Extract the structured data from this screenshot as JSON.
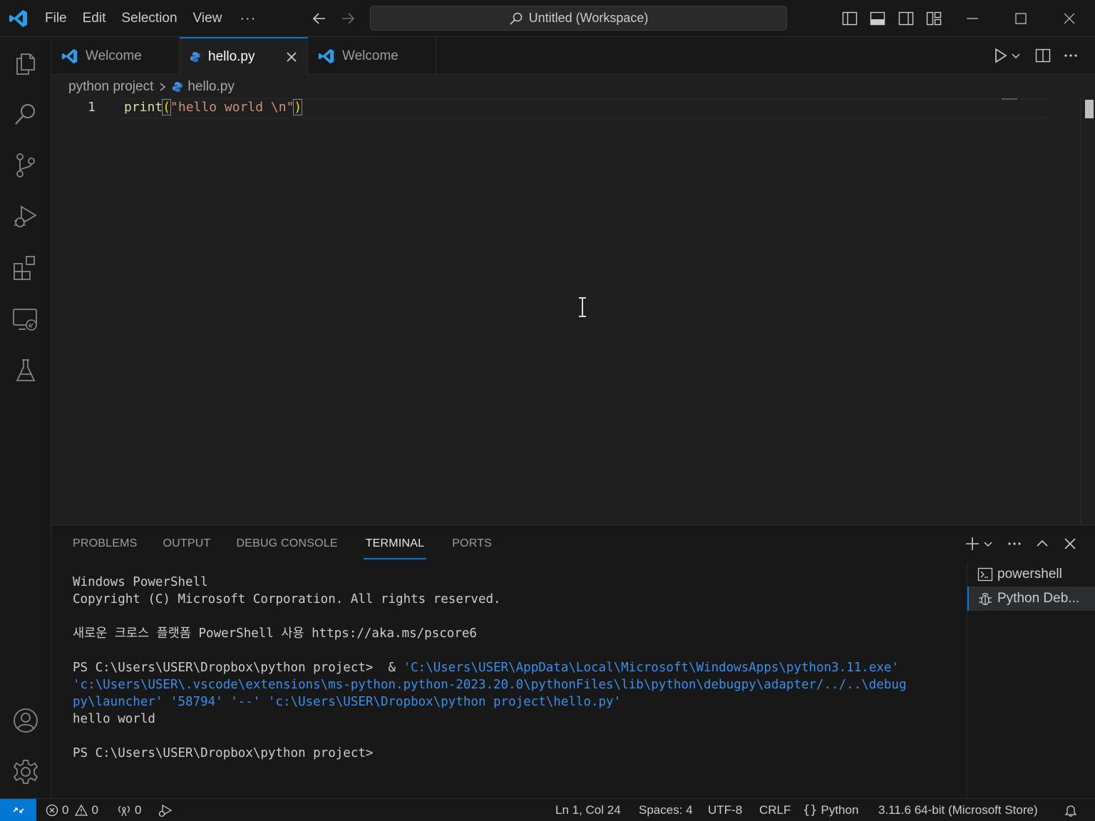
{
  "menu": [
    "File",
    "Edit",
    "Selection",
    "View"
  ],
  "menu_more": "···",
  "command_center": "Untitled (Workspace)",
  "tabs": [
    {
      "label": "Welcome",
      "icon": "vscode-icon"
    },
    {
      "label": "hello.py",
      "icon": "python-icon"
    },
    {
      "label": "Welcome",
      "icon": "vscode-icon"
    }
  ],
  "breadcrumb": {
    "folder": "python project",
    "file": "hello.py"
  },
  "editor": {
    "line_number": "1",
    "fn": "print",
    "open": "(",
    "string": "\"hello world \\n\"",
    "close": ")"
  },
  "panel": {
    "tabs": [
      "PROBLEMS",
      "OUTPUT",
      "DEBUG CONSOLE",
      "TERMINAL",
      "PORTS"
    ],
    "active_tab": "TERMINAL"
  },
  "terminal": {
    "l1": "Windows PowerShell",
    "l2": "Copyright (C) Microsoft Corporation. All rights reserved.",
    "l3": "새로운 크로스 플랫폼 PowerShell 사용 https://aka.ms/pscore6",
    "l4_prompt": "PS C:\\Users\\USER\\Dropbox\\python project>  & ",
    "l4_link": "'C:\\Users\\USER\\AppData\\Local\\Microsoft\\WindowsApps\\python3.11.exe'",
    "l5": "'c:\\Users\\USER\\.vscode\\extensions\\ms-python.python-2023.20.0\\pythonFiles\\lib\\python\\debugpy\\adapter/../..\\debug",
    "l6": "py\\launcher' '58794' '--' 'c:\\Users\\USER\\Dropbox\\python project\\hello.py'",
    "l7": "hello world",
    "l8": "PS C:\\Users\\USER\\Dropbox\\python project>"
  },
  "terminal_list": [
    "powershell",
    "Python Deb..."
  ],
  "status": {
    "errors": "0",
    "warnings": "0",
    "ports": "0",
    "position": "Ln 1, Col 24",
    "spaces": "Spaces: 4",
    "encoding": "UTF-8",
    "eol": "CRLF",
    "language": "Python",
    "interpreter": "3.11.6 64-bit (Microsoft Store)"
  },
  "colors": {
    "accent": "#0078d4",
    "bg": "#1f1f1f",
    "chrome": "#181818",
    "string": "#ce9178",
    "function": "#dcdcaa",
    "link": "#3b8eea"
  }
}
